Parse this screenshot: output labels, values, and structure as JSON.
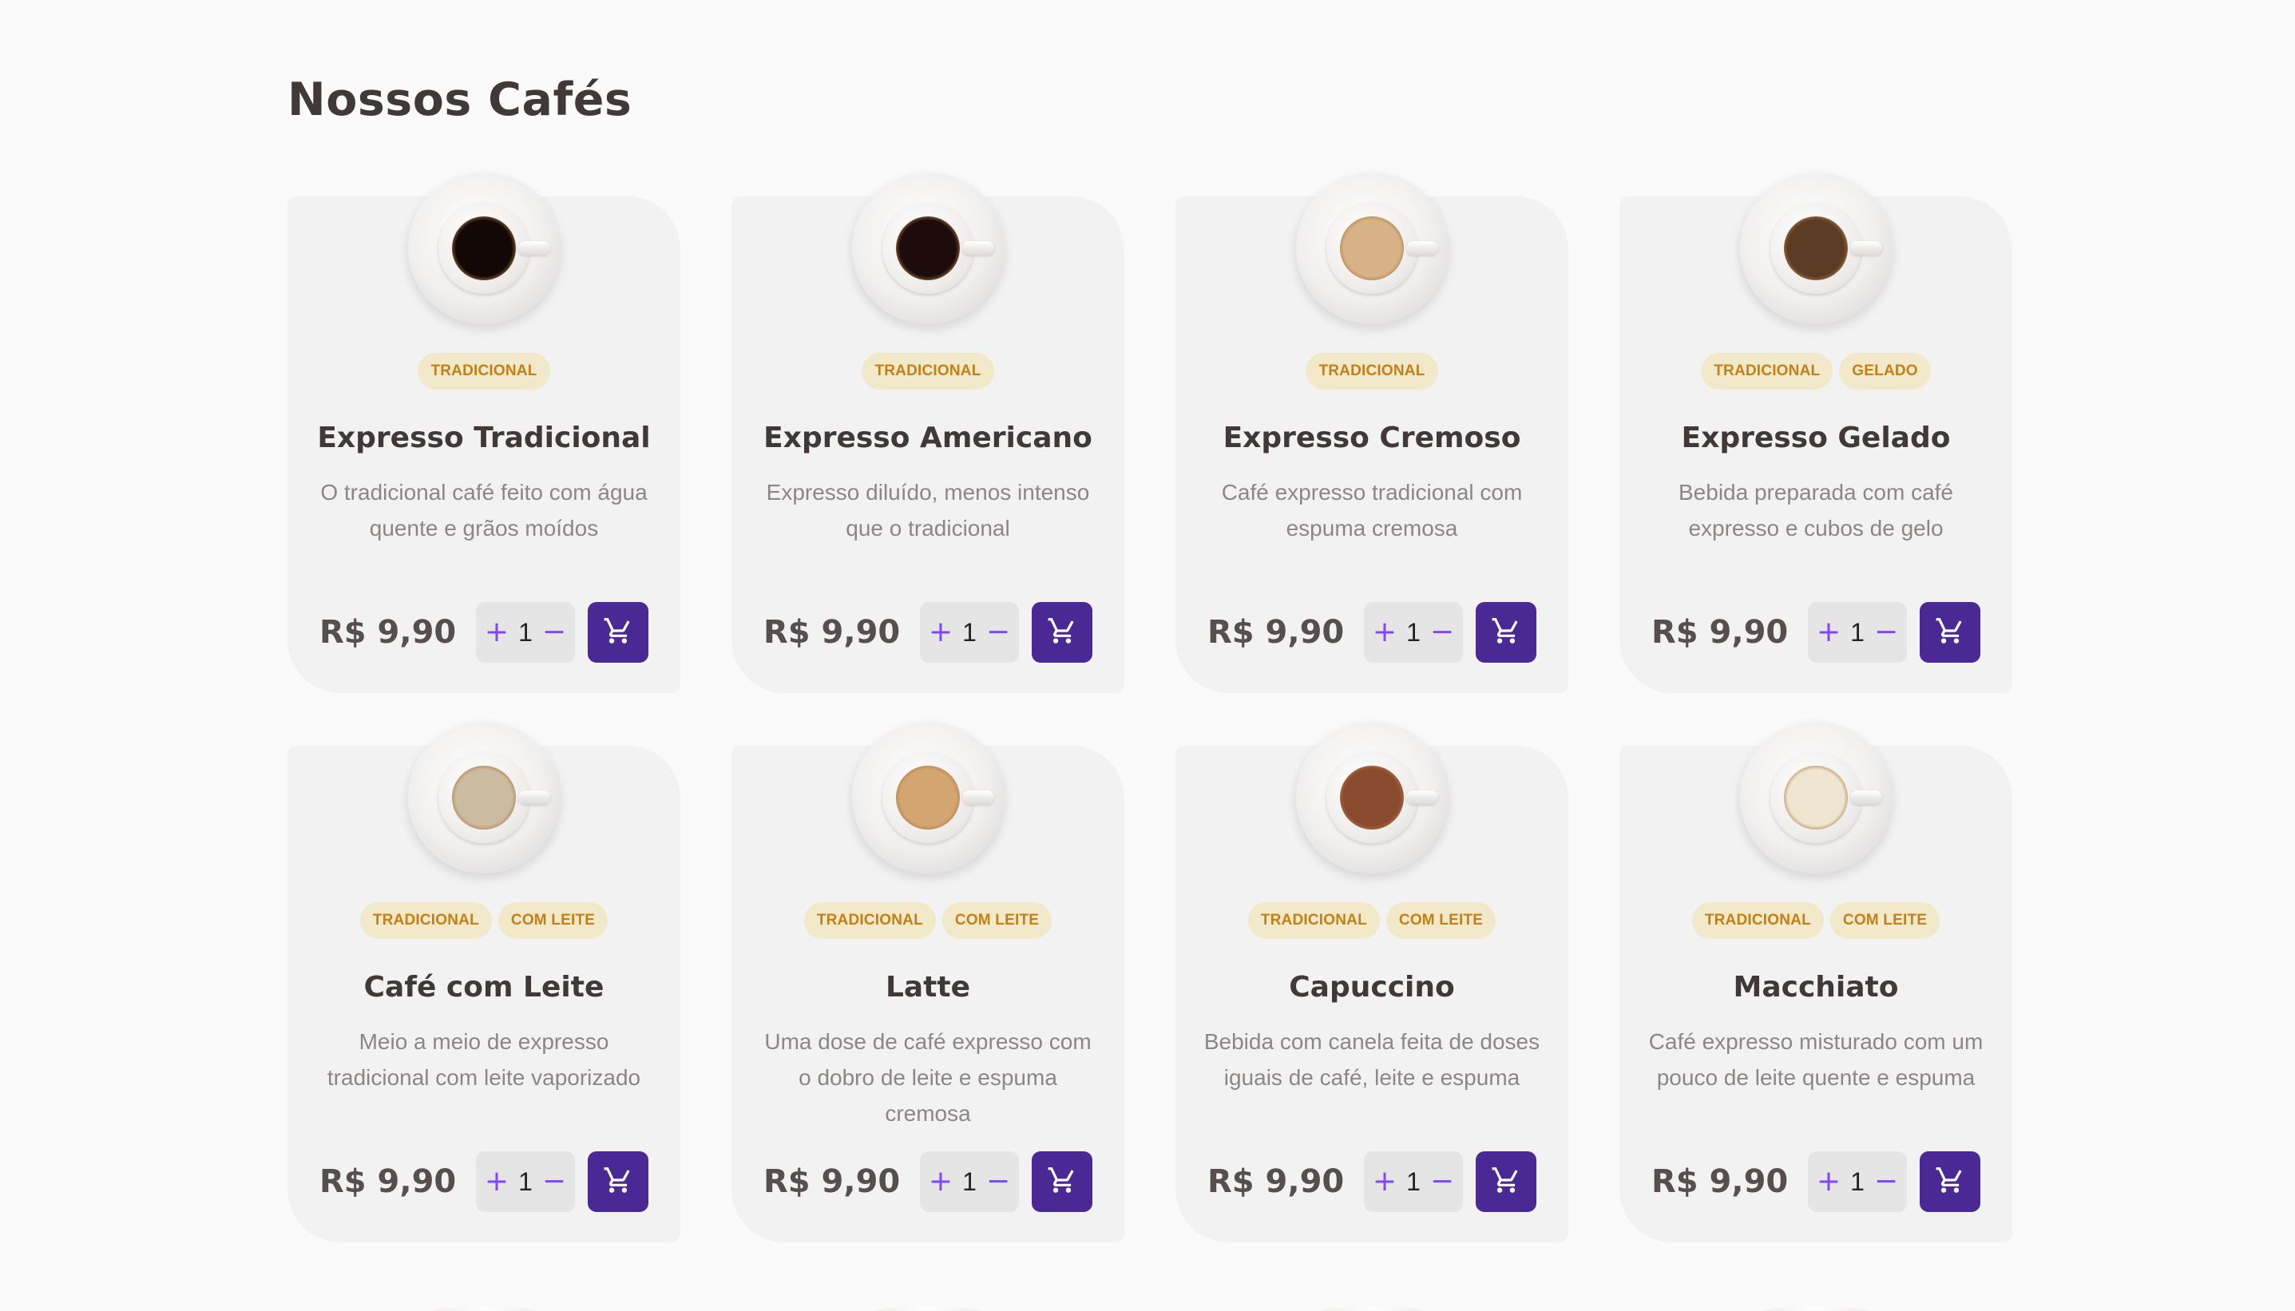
{
  "page": {
    "title": "Nossos Cafés"
  },
  "colors": {
    "background": "#FAFAFA",
    "card": "#F3F2F2",
    "tag_bg": "#F1E9C9",
    "tag_text": "#C47F17",
    "accent_purple": "#8047F8",
    "purple_dark": "#4B2995",
    "title": "#403937",
    "text": "#8D8686"
  },
  "products": [
    {
      "image_icon": "espresso-cup-icon",
      "coffee_color": "#120906",
      "tags": [
        "Tradicional"
      ],
      "name": "Expresso Tradicional",
      "description": "O tradicional café feito com água quente e grãos moídos",
      "price": "R$ 9,90",
      "quantity": "1",
      "plus": "+",
      "minus": "−"
    },
    {
      "image_icon": "americano-cup-icon",
      "coffee_color": "#1E0B0B",
      "tags": [
        "Tradicional"
      ],
      "name": "Expresso Americano",
      "description": "Expresso diluído, menos intenso que o tradicional",
      "price": "R$ 9,90",
      "quantity": "1",
      "plus": "+",
      "minus": "−"
    },
    {
      "image_icon": "cremoso-cup-icon",
      "coffee_color": "#D7B387",
      "tags": [
        "Tradicional"
      ],
      "name": "Expresso Cremoso",
      "description": "Café expresso tradicional com espuma cremosa",
      "price": "R$ 9,90",
      "quantity": "1",
      "plus": "+",
      "minus": "−"
    },
    {
      "image_icon": "iced-coffee-cup-icon",
      "coffee_color": "#5C3B24",
      "tags": [
        "Tradicional",
        "Gelado"
      ],
      "name": "Expresso Gelado",
      "description": "Bebida preparada com café expresso e cubos de gelo",
      "price": "R$ 9,90",
      "quantity": "1",
      "plus": "+",
      "minus": "−"
    },
    {
      "image_icon": "coffee-with-milk-cup-icon",
      "coffee_color": "#CBBBA0",
      "tags": [
        "Tradicional",
        "Com leite"
      ],
      "name": "Café com Leite",
      "description": "Meio a meio de expresso tradicional com leite vaporizado",
      "price": "R$ 9,90",
      "quantity": "1",
      "plus": "+",
      "minus": "−"
    },
    {
      "image_icon": "latte-cup-icon",
      "coffee_color": "#D3A571",
      "tags": [
        "Tradicional",
        "Com leite"
      ],
      "name": "Latte",
      "description": "Uma dose de café expresso com o dobro de leite e espuma cremosa",
      "price": "R$ 9,90",
      "quantity": "1",
      "plus": "+",
      "minus": "−"
    },
    {
      "image_icon": "capuccino-cup-icon",
      "coffee_color": "#8A4A2E",
      "tags": [
        "Tradicional",
        "Com leite"
      ],
      "name": "Capuccino",
      "description": "Bebida com canela feita de doses iguais de café, leite e espuma",
      "price": "R$ 9,90",
      "quantity": "1",
      "plus": "+",
      "minus": "−"
    },
    {
      "image_icon": "macchiato-cup-icon",
      "coffee_color": "#EFE6D2",
      "tags": [
        "Tradicional",
        "Com leite"
      ],
      "name": "Macchiato",
      "description": "Café expresso misturado com um pouco de leite quente e espuma",
      "price": "R$ 9,90",
      "quantity": "1",
      "plus": "+",
      "minus": "−"
    }
  ]
}
